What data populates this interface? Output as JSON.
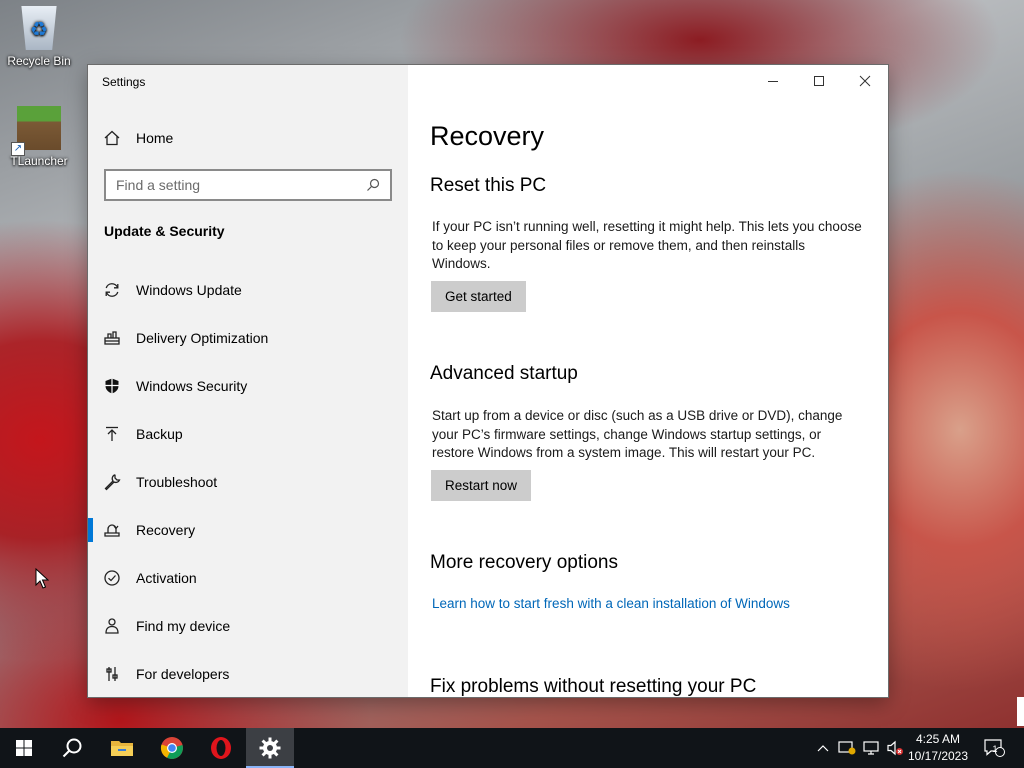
{
  "desktop": {
    "icons": [
      {
        "label": "Recycle Bin",
        "icon": "recycle-bin-icon"
      },
      {
        "label": "TLauncher",
        "icon": "tlauncher-icon"
      }
    ]
  },
  "window": {
    "title": "Settings",
    "sidebar": {
      "home_label": "Home",
      "search_placeholder": "Find a setting",
      "section_title": "Update & Security",
      "items": [
        {
          "label": "Windows Update",
          "icon": "refresh-icon"
        },
        {
          "label": "Delivery Optimization",
          "icon": "delivery-optimization-icon"
        },
        {
          "label": "Windows Security",
          "icon": "shield-icon"
        },
        {
          "label": "Backup",
          "icon": "backup-arrow-icon"
        },
        {
          "label": "Troubleshoot",
          "icon": "wrench-icon"
        },
        {
          "label": "Recovery",
          "icon": "recovery-icon",
          "active": true
        },
        {
          "label": "Activation",
          "icon": "check-circle-icon"
        },
        {
          "label": "Find my device",
          "icon": "person-pin-icon"
        },
        {
          "label": "For developers",
          "icon": "developer-sliders-icon"
        }
      ]
    },
    "content": {
      "page_title": "Recovery",
      "reset": {
        "heading": "Reset this PC",
        "description": "If your PC isn’t running well, resetting it might help. This lets you choose to keep your personal files or remove them, and then reinstalls Windows.",
        "button": "Get started"
      },
      "advanced": {
        "heading": "Advanced startup",
        "description": "Start up from a device or disc (such as a USB drive or DVD), change your PC’s firmware settings, change Windows startup settings, or restore Windows from a system image. This will restart your PC.",
        "button": "Restart now"
      },
      "more": {
        "heading": "More recovery options",
        "link": "Learn how to start fresh with a clean installation of Windows"
      },
      "fix_heading": "Fix problems without resetting your PC"
    }
  },
  "taskbar": {
    "apps": [
      "start-button",
      "search-icon",
      "file-explorer-icon",
      "chrome-icon",
      "opera-icon",
      "settings-gear-icon"
    ],
    "active_app": "settings-gear-icon",
    "clock": {
      "time": "4:25 AM",
      "date": "10/17/2023"
    },
    "notification_count": "1"
  },
  "colors": {
    "accent": "#0078d7",
    "link": "#0067b8",
    "sidebar_bg": "#f2f2f2",
    "button_bg": "#cccccc",
    "taskbar_bg": "#101418"
  }
}
